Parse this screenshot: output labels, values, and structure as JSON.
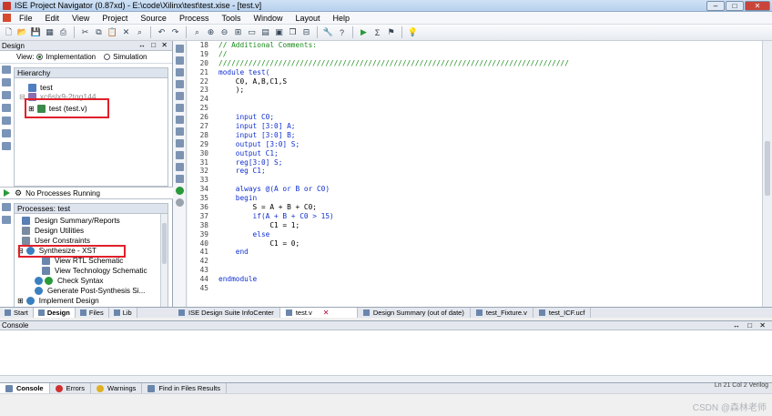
{
  "window": {
    "title": "ISE Project Navigator (0.87xd) - E:\\code\\Xilinx\\test\\test.xise - [test.v]",
    "controls": [
      "–",
      "□",
      "✕"
    ]
  },
  "menu": [
    "File",
    "Edit",
    "View",
    "Project",
    "Source",
    "Process",
    "Tools",
    "Window",
    "Layout",
    "Help"
  ],
  "design_panel": {
    "header": "Design",
    "header_controls": "↔ □ ✕",
    "view_label": "View:",
    "implementation_label": "Implementation",
    "simulation_label": "Simulation",
    "hierarchy_header": "Hierarchy",
    "tree": [
      {
        "label": "test"
      },
      {
        "label": "xc6slx9-2tqg144"
      },
      {
        "label": "test (test.v)"
      }
    ],
    "process_status": "No Processes Running",
    "processes_header": "Processes: test",
    "processes": [
      {
        "label": "Design Summary/Reports"
      },
      {
        "label": "Design Utilities"
      },
      {
        "label": "User Constraints"
      },
      {
        "label": "Synthesize - XST"
      },
      {
        "label": "View RTL Schematic"
      },
      {
        "label": "View Technology Schematic"
      },
      {
        "label": "Check Syntax"
      },
      {
        "label": "Generate Post-Synthesis Si..."
      },
      {
        "label": "Implement Design"
      }
    ],
    "bottom_tabs": [
      "Start",
      "Design",
      "Files",
      "Lib"
    ]
  },
  "editor": {
    "line_numbers": [
      "18",
      "19",
      "20",
      "21",
      "22",
      "23",
      "24",
      "25",
      "26",
      "27",
      "28",
      "29",
      "30",
      "31",
      "32",
      "33",
      "34",
      "35",
      "36",
      "37",
      "38",
      "39",
      "40",
      "41",
      "42",
      "43",
      "44",
      "45"
    ],
    "lines": [
      {
        "text": "// Additional Comments:",
        "kind": "comment"
      },
      {
        "text": "//",
        "kind": "comment"
      },
      {
        "text": "//////////////////////////////////////////////////////////////////////////////////",
        "kind": "comment"
      },
      {
        "text": "module test(",
        "kind": "kw"
      },
      {
        "text": "    C0, A,B,C1,S",
        "kind": "plain"
      },
      {
        "text": "    );",
        "kind": "plain"
      },
      {
        "text": "",
        "kind": "plain"
      },
      {
        "text": "",
        "kind": "plain"
      },
      {
        "text": "    input C0;",
        "kind": "kw"
      },
      {
        "text": "    input [3:0] A;",
        "kind": "kw"
      },
      {
        "text": "    input [3:0] B;",
        "kind": "kw"
      },
      {
        "text": "    output [3:0] S;",
        "kind": "kw"
      },
      {
        "text": "    output C1;",
        "kind": "kw"
      },
      {
        "text": "    reg[3:0] S;",
        "kind": "kw"
      },
      {
        "text": "    reg C1;",
        "kind": "kw"
      },
      {
        "text": "",
        "kind": "plain"
      },
      {
        "text": "    always @(A or B or C0)",
        "kind": "kw"
      },
      {
        "text": "    begin",
        "kind": "kw"
      },
      {
        "text": "        S = A + B + C0;",
        "kind": "plain"
      },
      {
        "text": "        if(A + B + C0 > 15)",
        "kind": "kw"
      },
      {
        "text": "            C1 = 1;",
        "kind": "plain"
      },
      {
        "text": "        else",
        "kind": "kw"
      },
      {
        "text": "            C1 = 0;",
        "kind": "plain"
      },
      {
        "text": "    end",
        "kind": "kw"
      },
      {
        "text": "",
        "kind": "plain"
      },
      {
        "text": "",
        "kind": "plain"
      },
      {
        "text": "endmodule",
        "kind": "kw"
      },
      {
        "text": "",
        "kind": "plain"
      }
    ],
    "tabs": [
      {
        "label": "ISE Design Suite InfoCenter"
      },
      {
        "label": "test.v",
        "active": true,
        "close": "✕"
      },
      {
        "label": "Design Summary (out of date)"
      },
      {
        "label": "test_Fixture.v"
      },
      {
        "label": "test_ICF.ucf"
      }
    ]
  },
  "console": {
    "header": "Console",
    "header_controls": "↔ □ ✕",
    "tabs": [
      "Console",
      "Errors",
      "Warnings",
      "Find in Files Results"
    ],
    "position": "Ln 21 Col 2 Verilog"
  },
  "watermark": "CSDN @森林老师",
  "colors": {
    "comment": "#1a8a1a",
    "keyword": "#1030d0",
    "highlight_box": "#e0202a"
  }
}
